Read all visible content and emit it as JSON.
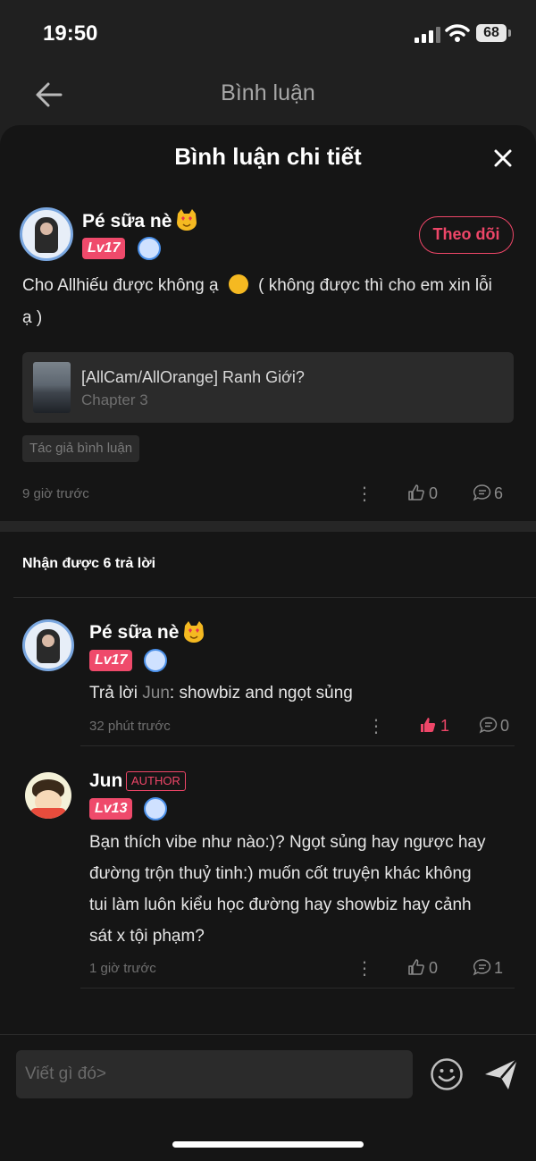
{
  "status_bar": {
    "time": "19:50",
    "battery": "68"
  },
  "header": {
    "title": "Bình luận"
  },
  "sheet": {
    "title": "Bình luận chi tiết"
  },
  "main_comment": {
    "author": "Pé sữa nè",
    "level": "Lv17",
    "follow_label": "Theo dõi",
    "text_line1": "Cho Allhiếu được không ạ",
    "text_line1b": "( không được thì cho em xin lỗi",
    "text_line2": "ạ )",
    "ref_title": "[AllCam/AllOrange] Ranh Giới?",
    "ref_sub": "Chapter 3",
    "tag": "Tác giả bình luận",
    "time": "9 giờ trước",
    "likes": "0",
    "replies": "6"
  },
  "replies_header": "Nhận được 6 trả lời",
  "replies": [
    {
      "author": "Pé sữa nè",
      "level": "Lv17",
      "prefix": "Trả lời ",
      "mention": "Jun",
      "text": ": showbiz and ngọt sủng",
      "time": "32 phút trước",
      "likes": "1",
      "comments": "0"
    },
    {
      "author": "Jun",
      "author_tag": "AUTHOR",
      "level": "Lv13",
      "lines": [
        "Bạn thích vibe như nào:)? Ngọt sủng hay ngược hay",
        "đường trộn thuỷ tinh:) muốn cốt truyện khác không",
        "tui làm luôn kiểu học đường hay showbiz hay cảnh",
        "sát x tội phạm?"
      ],
      "time": "1 giờ trước",
      "likes": "0",
      "comments": "1"
    }
  ],
  "composer": {
    "placeholder": "Viết gì đó>"
  },
  "colors": {
    "accent": "#ee4668",
    "background": "#151515"
  }
}
